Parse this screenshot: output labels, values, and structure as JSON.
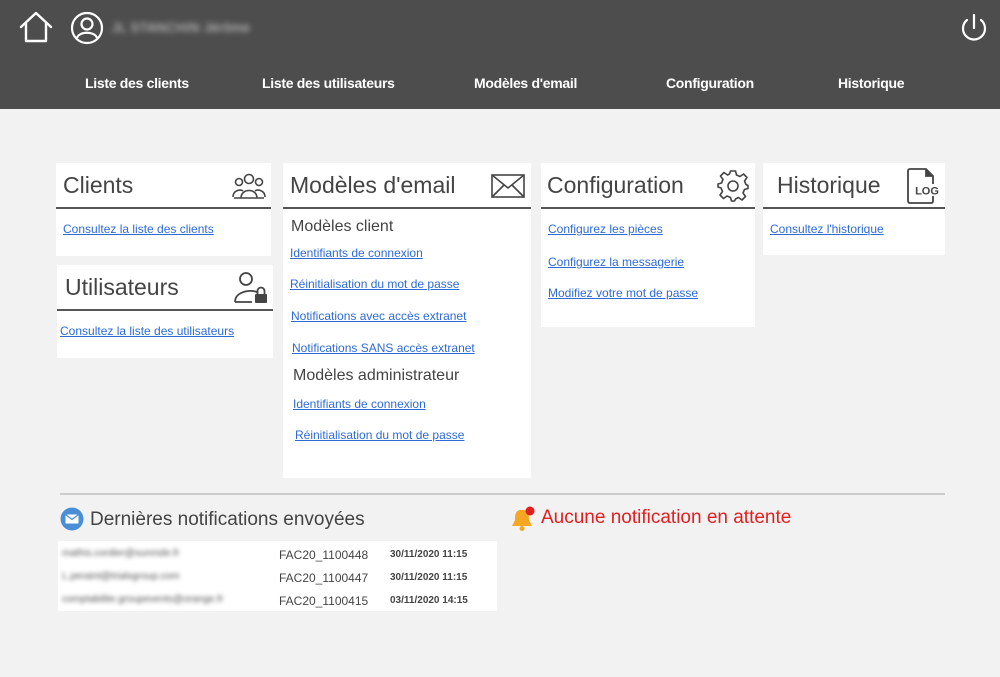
{
  "header": {
    "username": "JL STANCHIN Jérôme",
    "nav": [
      {
        "label": "Liste des clients"
      },
      {
        "label": "Liste des utilisateurs"
      },
      {
        "label": "Modèles d'email"
      },
      {
        "label": "Configuration"
      },
      {
        "label": "Historique"
      }
    ]
  },
  "clients": {
    "title": "Clients",
    "link": "Consultez la liste des clients"
  },
  "utilisateurs": {
    "title": "Utilisateurs",
    "link": "Consultez la liste des utilisateurs"
  },
  "modeles": {
    "title": "Modèles d'email",
    "client_heading": "Modèles client",
    "client_links": [
      "Identifiants de connexion",
      "Réinitialisation du mot de passe",
      "Notifications avec accès extranet",
      "Notifications SANS accès extranet"
    ],
    "admin_heading": "Modèles administrateur",
    "admin_links": [
      "Identifiants de connexion",
      "Réinitialisation du mot de passe"
    ]
  },
  "configuration": {
    "title": "Configuration",
    "links": [
      "Configurez les pièces",
      "Configurez la messagerie",
      "Modifiez votre mot de passe"
    ]
  },
  "historique": {
    "title": "Historique",
    "icon_text": "LOG",
    "link": "Consultez l'historique"
  },
  "notifications": {
    "title": "Dernières notifications envoyées",
    "rows": [
      {
        "email": "mathis.cordier@sunmde.fr",
        "ref": "FAC20_1100448",
        "date": "30/11/2020 11:15"
      },
      {
        "email": "L.peraint@trialsgroup.com",
        "ref": "FAC20_1100447",
        "date": "30/11/2020 11:15"
      },
      {
        "email": "comptabilite.groupevents@orange.fr",
        "ref": "FAC20_1100415",
        "date": "03/11/2020 14:15"
      }
    ],
    "pending": "Aucune notification en attente"
  },
  "colors": {
    "header_bg": "#4d4d4d",
    "link": "#2e6bd6",
    "alert": "#e02020",
    "bell": "#f5a623"
  }
}
